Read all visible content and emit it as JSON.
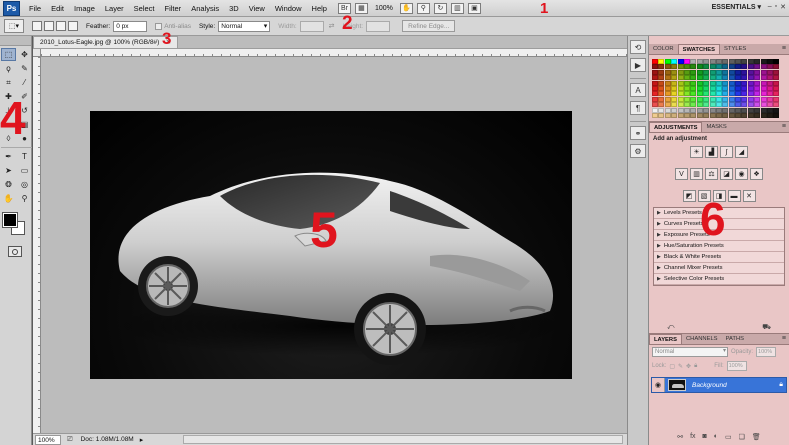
{
  "menubar": {
    "logo": "Ps",
    "menu": [
      "File",
      "Edit",
      "Image",
      "Layer",
      "Select",
      "Filter",
      "Analysis",
      "3D",
      "View",
      "Window",
      "Help"
    ],
    "zoom": "100%",
    "workspace": "ESSENTIALS"
  },
  "options": {
    "feather_label": "Feather:",
    "feather_value": "0 px",
    "antialias_label": "Anti-alias",
    "style_label": "Style:",
    "style_value": "Normal",
    "width_label": "Width:",
    "height_label": "Height:",
    "refine_label": "Refine Edge..."
  },
  "document": {
    "tab_title": "2010_Lotus-Eagle.jpg @ 100% (RGB/8#)",
    "status_zoom": "100%",
    "status_doc": "Doc: 1.08M/1.08M"
  },
  "panels": {
    "color_tabs": [
      "Color",
      "Swatches",
      "Styles"
    ],
    "color_active": 1,
    "adjust_tabs": [
      "Adjustments",
      "Masks"
    ],
    "adjust_title": "Add an adjustment",
    "presets": [
      "Levels Presets",
      "Curves Presets",
      "Exposure Presets",
      "Hue/Saturation Presets",
      "Black & White Presets",
      "Channel Mixer Presets",
      "Selective Color Presets"
    ],
    "layer_tabs": [
      "Layers",
      "Channels",
      "Paths"
    ],
    "blend_mode": "Normal",
    "opacity_label": "Opacity:",
    "opacity_value": "100%",
    "lock_label": "Lock:",
    "fill_label": "Fill:",
    "fill_value": "100%",
    "layer_name": "Background"
  },
  "annotations": [
    "1",
    "2",
    "3",
    "4",
    "5",
    "6"
  ],
  "colors": {
    "annotation": "#e0141e",
    "panel_bg": "#e9c6c6",
    "layer_selected": "#3874d8"
  }
}
